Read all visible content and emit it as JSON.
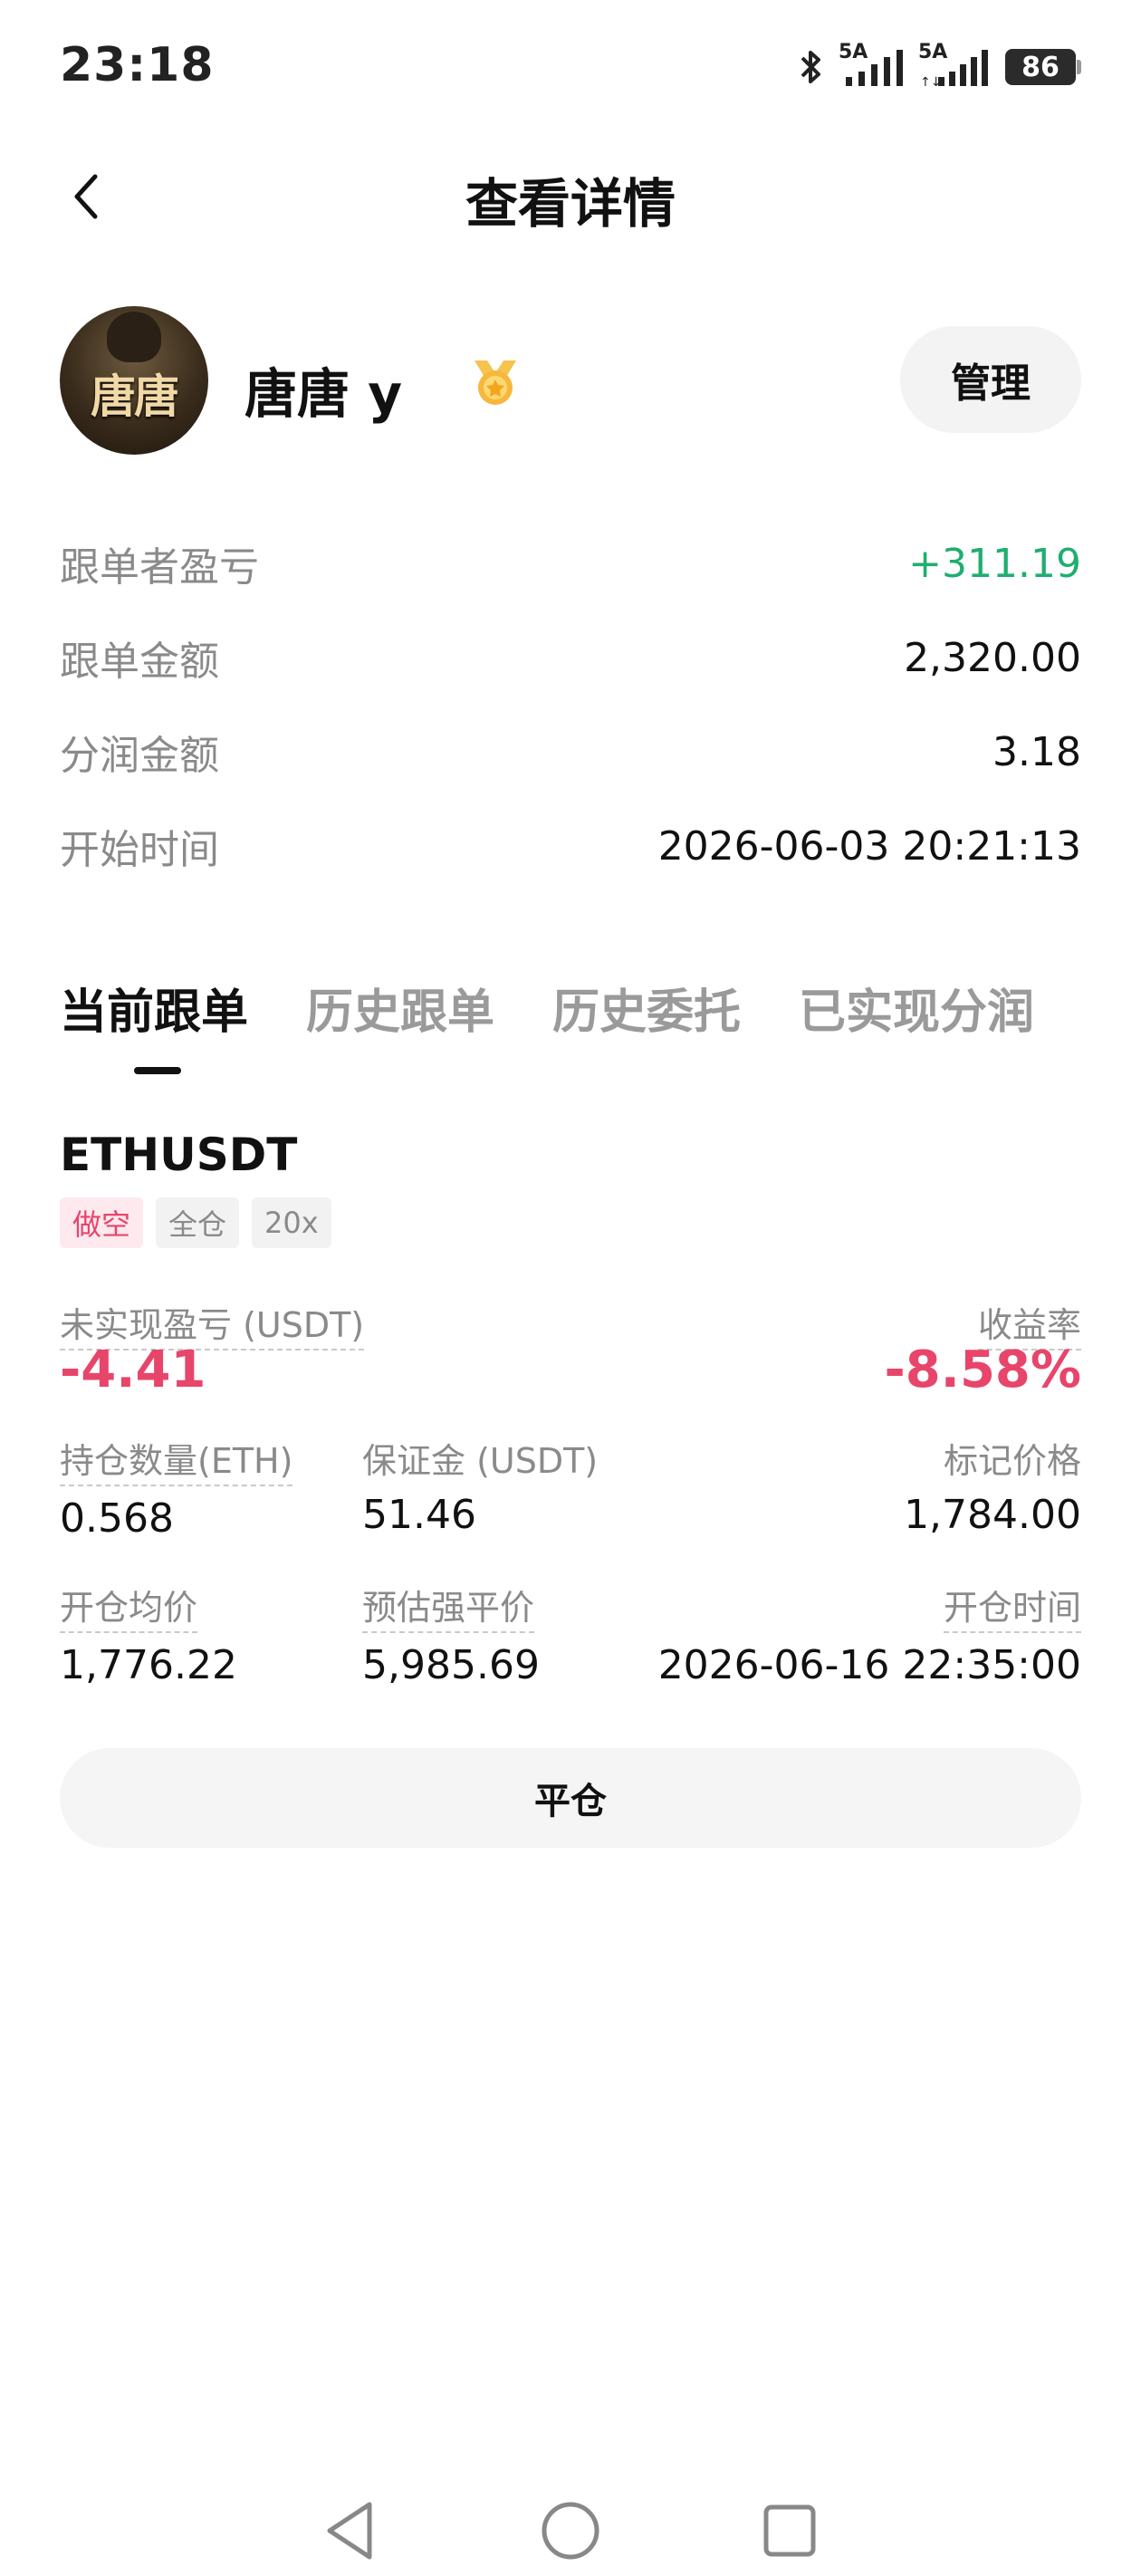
{
  "status_bar": {
    "time": "23:18",
    "network_1": "5A",
    "network_2": "5A",
    "battery": "86"
  },
  "header": {
    "title": "查看详情"
  },
  "profile": {
    "avatar_text": "唐唐",
    "username": "唐唐 y",
    "manage_label": "管理"
  },
  "summary": {
    "rows": [
      {
        "label": "跟单者盈亏",
        "value": "+311.19"
      },
      {
        "label": "跟单金额",
        "value": "2,320.00"
      },
      {
        "label": "分润金额",
        "value": "3.18"
      },
      {
        "label": "开始时间",
        "value": "2026-06-03 20:21:13"
      }
    ]
  },
  "tabs": [
    {
      "label": "当前跟单",
      "active": true
    },
    {
      "label": "历史跟单",
      "active": false
    },
    {
      "label": "历史委托",
      "active": false
    },
    {
      "label": "已实现分润",
      "active": false
    }
  ],
  "position": {
    "symbol": "ETHUSDT",
    "tags": [
      "做空",
      "全仓",
      "20x"
    ],
    "unrealized_pnl_label": "未实现盈亏 (USDT)",
    "unrealized_pnl": "-4.41",
    "roi_label": "收益率",
    "roi": "-8.58%",
    "size_label": "持仓数量(ETH)",
    "size": "0.568",
    "margin_label": "保证金 (USDT)",
    "margin": "51.46",
    "mark_price_label": "标记价格",
    "mark_price": "1,784.00",
    "entry_price_label": "开仓均价",
    "entry_price": "1,776.22",
    "liq_price_label": "预估强平价",
    "liq_price": "5,985.69",
    "open_time_label": "开仓时间",
    "open_time": "2026-06-16 22:35:00",
    "close_label": "平仓"
  },
  "colors": {
    "positive": "#1fae6f",
    "negative": "#e8456b"
  }
}
